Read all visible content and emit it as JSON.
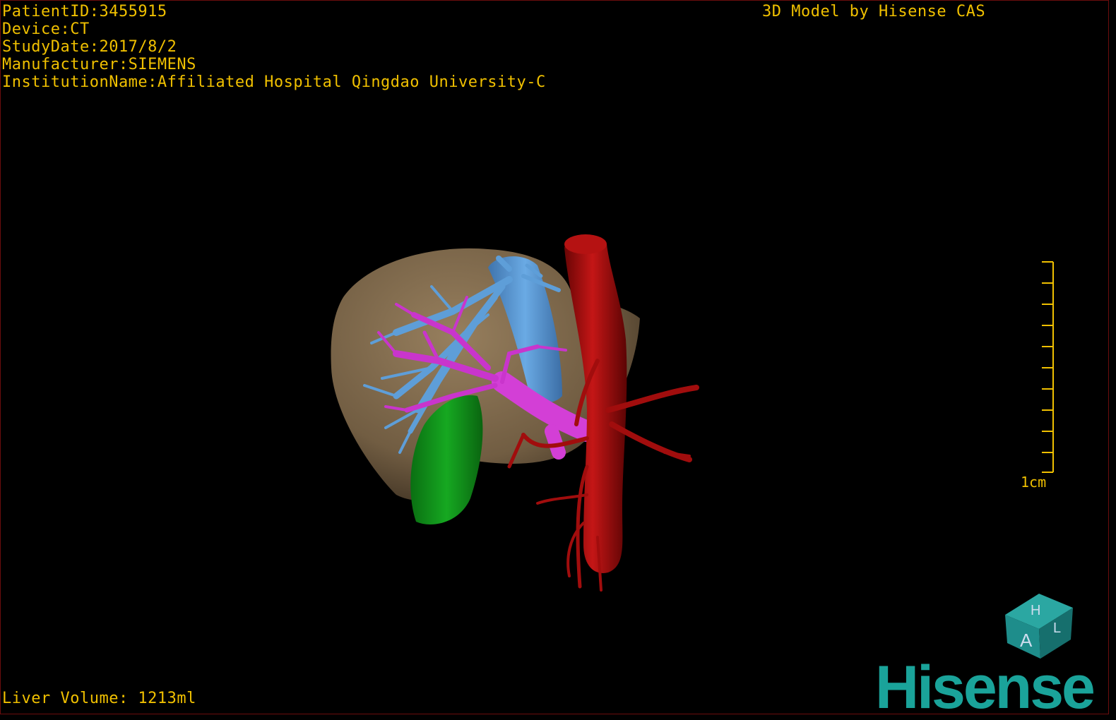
{
  "info": {
    "patient_id": "PatientID:3455915",
    "device": "Device:CT",
    "study_date": "StudyDate:2017/8/2",
    "manufacturer": "Manufacturer:SIEMENS",
    "institution": "InstitutionName:Affiliated Hospital Qingdao University-C"
  },
  "model_credit": "3D Model by Hisense CAS",
  "liver_volume": "Liver Volume: 1213ml",
  "scale_bar": {
    "label": "1cm"
  },
  "orientation_cube": {
    "face_front": "A",
    "face_top": "H",
    "face_side": "L",
    "color": "#1e8d8b"
  },
  "brand": {
    "name": "Hisense",
    "color": "#1aa39a"
  },
  "colors": {
    "overlay_text": "#f0c000",
    "liver": "#8a7456",
    "hepatic_vein": "#5e9ed8",
    "portal_vein": "#d33fd6",
    "gallbladder": "#0f9a1a",
    "aorta": "#a10d0d"
  }
}
